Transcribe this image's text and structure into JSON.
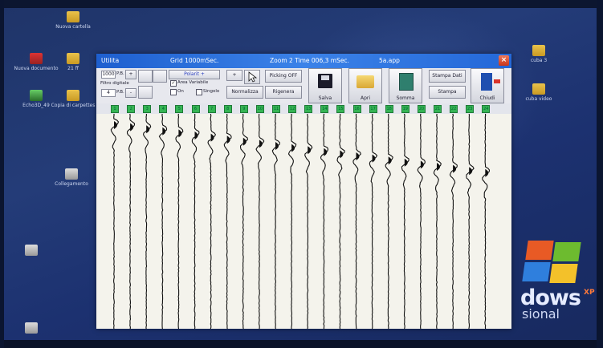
{
  "desktop": {
    "icons": [
      {
        "label": "Nuova cartella",
        "kind": "folder"
      },
      {
        "label": "Nuova documento",
        "kind": "app-red"
      },
      {
        "label": "21 ff",
        "kind": "folder"
      },
      {
        "label": "Echo3D_49",
        "kind": "app-grn"
      },
      {
        "label": "Copia di carpettes",
        "kind": "folder"
      },
      {
        "label": "Collegamento",
        "kind": "doc"
      },
      {
        "label": "",
        "kind": "doc"
      },
      {
        "label": "",
        "kind": "doc"
      },
      {
        "label": "cuba 3",
        "kind": "folder"
      },
      {
        "label": "cuba video",
        "kind": "folder"
      }
    ],
    "os_brand": {
      "line1": "dows",
      "line2": "sional",
      "xp": "XP"
    }
  },
  "window": {
    "title_app": "Utilita",
    "title_grid": "Grid 1000mSec.",
    "title_zoom": "Zoom 2  Time 006,3 mSec.",
    "title_file": "5a.app",
    "close_glyph": "×"
  },
  "toolbar": {
    "field_trace": "1000",
    "label_pb1": "P.B.",
    "label_filtro": "Filtro digitale",
    "field_filtro": "4",
    "label_pb2": "P.B.",
    "polarity_label": "Polarit +",
    "area_variable": "Area Variabile",
    "check_on": "On",
    "check_single": "Singolo",
    "normalize_label": "Normalizza",
    "picking_label": "Picking OFF",
    "riprova_label": "Rigenera",
    "save_label": "Salva",
    "open_label": "Apri",
    "somma_label": "Somma",
    "print_data_label": "Stampa Dati",
    "print_label": "Stampa",
    "exit_label": "Chiudi",
    "plus_glyph": "+",
    "minus_glyph": "-"
  },
  "traces": {
    "numbers": [
      "1",
      "2",
      "3",
      "4",
      "5",
      "6",
      "7",
      "8",
      "9",
      "10",
      "11",
      "12",
      "13",
      "14",
      "15",
      "16",
      "17",
      "18",
      "19",
      "20",
      "21",
      "22",
      "23",
      "24"
    ],
    "count": 24
  },
  "colors": {
    "title_blue": "#1e5fcf",
    "trace_green": "#35b454",
    "wiggle": "#111111",
    "desktop_blue": "#1f3468"
  }
}
